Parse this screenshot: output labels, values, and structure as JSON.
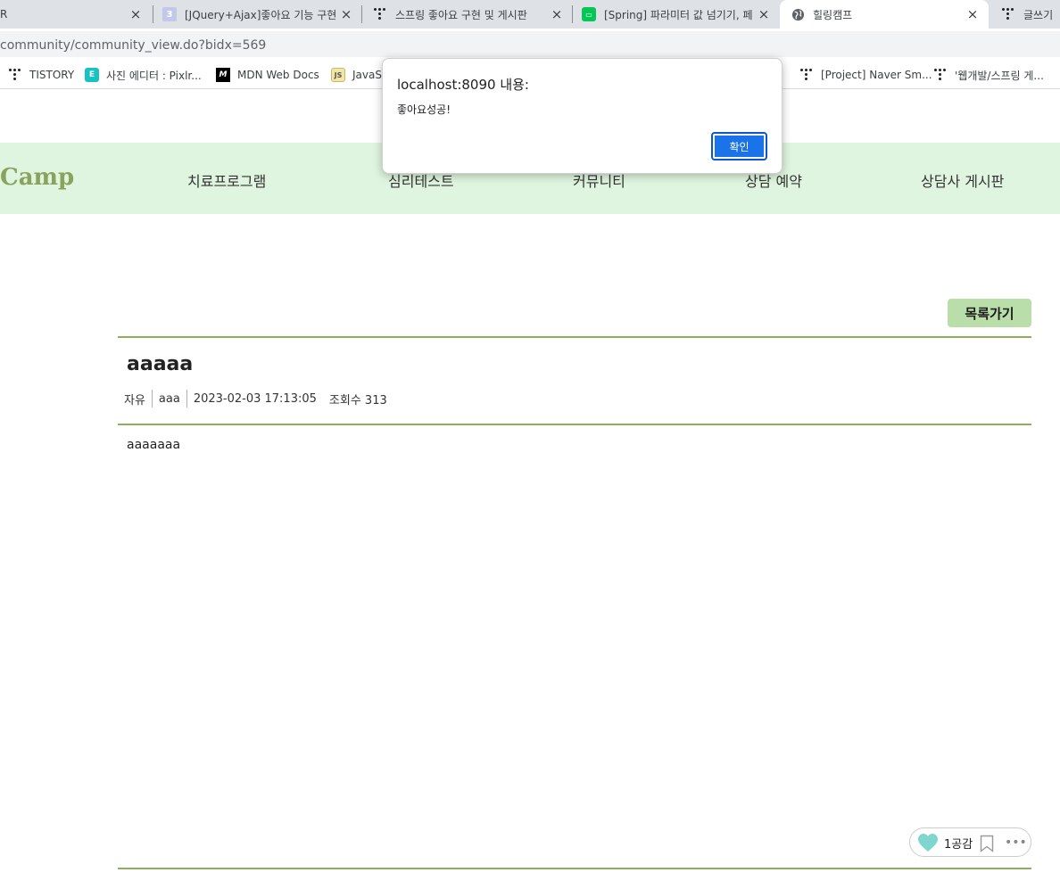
{
  "browser": {
    "tabs": [
      {
        "title": "R",
        "icon": "tab-icon-none"
      },
      {
        "title": "[JQuery+Ajax]좋아요 기능 구현",
        "icon": "number-3-icon"
      },
      {
        "title": "스프링 좋아요 구현 및 게시판",
        "icon": "tistory-icon"
      },
      {
        "title": "[Spring] 파라미터 값 넘기기, 페",
        "icon": "line-blog-icon"
      },
      {
        "title": "힐링캠프",
        "icon": "globe-icon",
        "active": true
      },
      {
        "title": "글쓰기",
        "icon": "tistory-icon"
      }
    ],
    "close_glyph": "×",
    "address": "community/community_view.do?bidx=569",
    "bookmarks": [
      {
        "label": "TISTORY",
        "icon": "tistory-icon"
      },
      {
        "label": "사진 에디터 : Pixlr...",
        "icon": "pixlr-icon"
      },
      {
        "label": "MDN Web Docs",
        "icon": "mdn-icon"
      },
      {
        "label": "JavaSc",
        "icon": "javascript-icon"
      },
      {
        "label": "[Project] Naver Sm...",
        "icon": "tistory-icon"
      },
      {
        "label": "'웹개발/스프링 게...",
        "icon": "tistory-icon"
      }
    ]
  },
  "site": {
    "logo": "Camp",
    "nav": [
      "치료프로그램",
      "심리테스트",
      "커뮤니티",
      "상담 예약",
      "상담사 게시판"
    ],
    "list_button": "목록가기"
  },
  "post": {
    "title": "aaaaa",
    "category": "자유",
    "author": "aaa",
    "date": "2023-02-03 17:13:05",
    "views": "조회수 313",
    "body": "aaaaaaa",
    "like_label": "1공감",
    "more_glyph": "•••"
  },
  "alert": {
    "origin": "localhost:8090 내용:",
    "message": "좋아요성공!",
    "ok_label": "확인"
  },
  "colors": {
    "nav_bg": "#dff5df",
    "logo": "#8aa35c",
    "divider": "#8cb05a",
    "list_button": "#b9deaa",
    "heart": "#7fd6cf",
    "alert_button": "#1a73e8"
  }
}
